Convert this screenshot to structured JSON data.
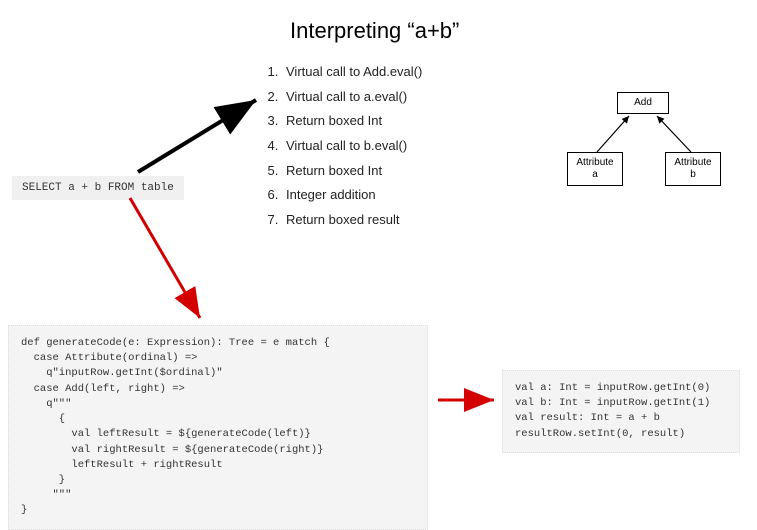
{
  "title": "Interpreting “a+b”",
  "steps": [
    "Virtual call to Add.eval()",
    "Virtual call to a.eval()",
    "Return boxed Int",
    "Virtual call to b.eval()",
    "Return boxed Int",
    "Integer addition",
    "Return boxed result"
  ],
  "sql": "SELECT a + b FROM table",
  "tree": {
    "root": "Add",
    "left": "Attribute\na",
    "right": "Attribute\nb"
  },
  "code_gen": "def generateCode(e: Expression): Tree = e match {\n  case Attribute(ordinal) =>\n    q\"inputRow.getInt($ordinal)\"\n  case Add(left, right) =>\n    q\"\"\"\n      {\n        val leftResult = ${generateCode(left)}\n        val rightResult = ${generateCode(right)}\n        leftResult + rightResult\n      }\n     \"\"\"\n}",
  "code_out": "val a: Int = inputRow.getInt(0)\nval b: Int = inputRow.getInt(1)\nval result: Int = a + b\nresultRow.setInt(0, result)"
}
